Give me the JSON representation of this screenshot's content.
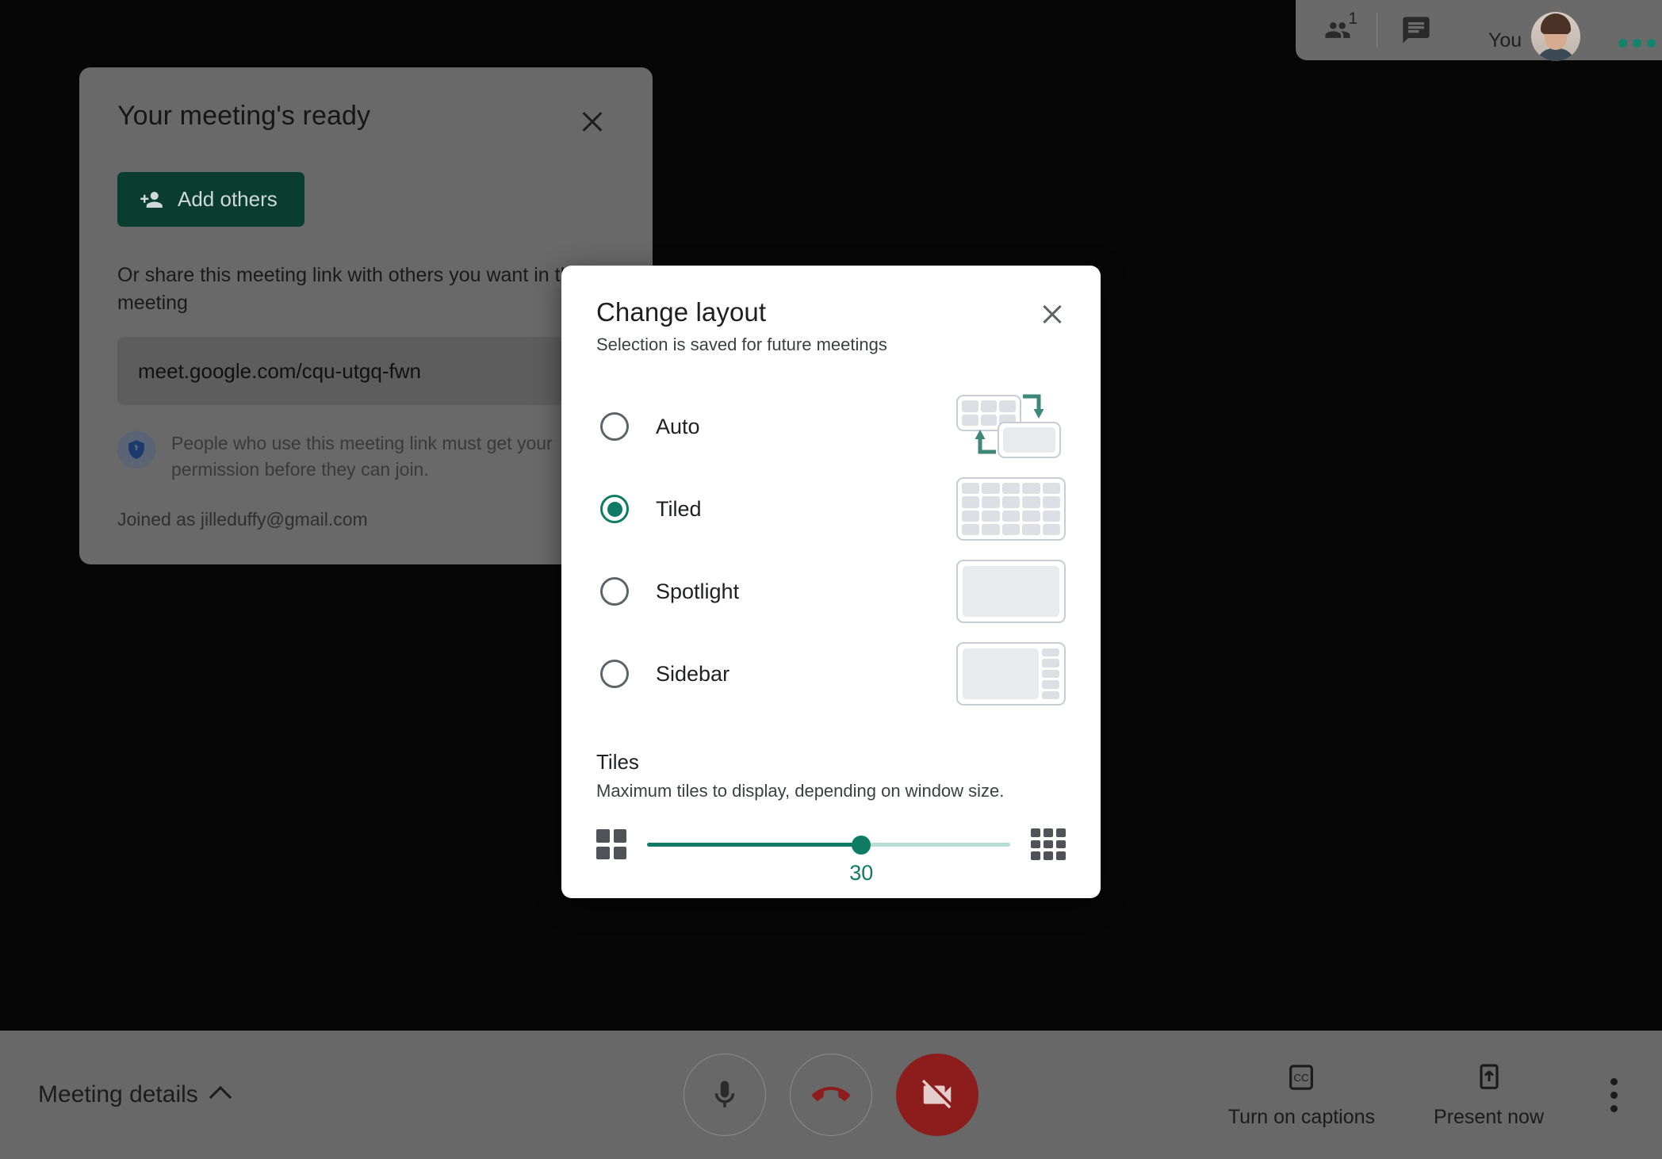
{
  "header": {
    "participants_count": "1",
    "people_icon": "people-icon",
    "chat_icon": "chat-icon",
    "you_label": "You",
    "avatar": "avatar",
    "more_dots": "three-dots-teal"
  },
  "meeting_card": {
    "title": "Your meeting's ready",
    "close_icon": "close-icon",
    "add_others_label": "Add others",
    "add_others_icon": "person-add-icon",
    "share_text": "Or share this meeting link with others you want in the meeting",
    "meeting_link": "meet.google.com/cqu-utgq-fwn",
    "shield_icon": "shield-lock-icon",
    "permission_text": "People who use this meeting link must get your permission before they can join.",
    "joined_as": "Joined as jilleduffy@gmail.com",
    "accent_color": "#0b3c30"
  },
  "dialog": {
    "title": "Change layout",
    "subtitle": "Selection is saved for future meetings",
    "close_icon": "close-icon",
    "accent_color": "#0f7b64",
    "options": [
      {
        "label": "Auto",
        "selected": false,
        "preview": "auto-layout-preview"
      },
      {
        "label": "Tiled",
        "selected": true,
        "preview": "tiled-layout-preview"
      },
      {
        "label": "Spotlight",
        "selected": false,
        "preview": "spotlight-layout-preview"
      },
      {
        "label": "Sidebar",
        "selected": false,
        "preview": "sidebar-layout-preview"
      }
    ],
    "tiles": {
      "title": "Tiles",
      "subtitle": "Maximum tiles to display, depending on window size.",
      "value": "30",
      "percent": 59,
      "min_icon": "grid-2x2-icon",
      "max_icon": "grid-3x3-icon"
    }
  },
  "bottom_bar": {
    "meeting_details": "Meeting details",
    "chevron_icon": "chevron-up-icon",
    "mic_icon": "microphone-icon",
    "hangup_icon": "end-call-icon",
    "camera_icon": "camera-off-icon",
    "captions_label": "Turn on captions",
    "captions_icon": "closed-captions-icon",
    "present_label": "Present now",
    "present_icon": "present-screen-icon",
    "more_icon": "more-vertical-icon",
    "danger_color": "#8d1d1d"
  }
}
